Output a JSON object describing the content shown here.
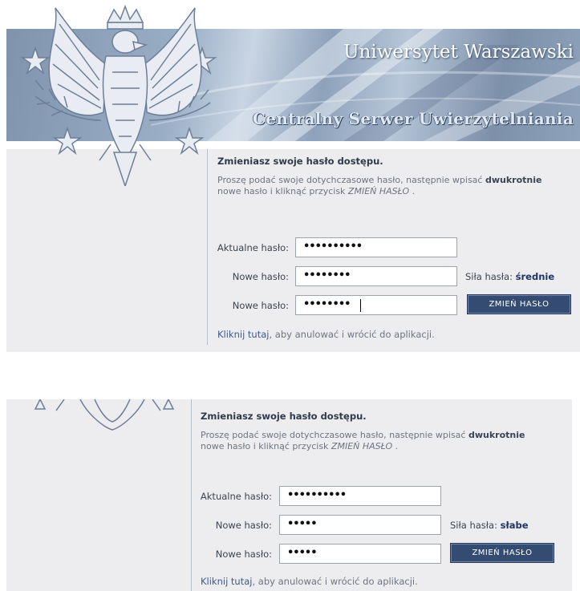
{
  "header": {
    "university": "Uniwersytet Warszawski",
    "service": "Centralny Serwer Uwierzytelniania"
  },
  "colors": {
    "banner": "#8a9eb8",
    "panel": "#ededef",
    "button": "#344b72",
    "link": "#3d5a8c",
    "strength_value": "#1f3566"
  },
  "form1": {
    "heading": "Zmieniasz swoje hasło dostępu.",
    "instr_prefix": "Proszę podać swoje dotychczasowe hasło, następnie wpisać ",
    "instr_bold": "dwukrotnie",
    "instr_mid": "nowe hasło i kliknąć przycisk ",
    "instr_italic": "ZMIEŃ HASŁO",
    "instr_suffix": " .",
    "current_label": "Aktualne hasło:",
    "current_value": "••••••••••",
    "new_label": "Nowe hasło:",
    "new_value": "••••••••",
    "repeat_label": "Nowe hasło:",
    "repeat_value": "••••••••",
    "strength_label": "Siła hasła: ",
    "strength_value": "średnie",
    "submit": "ZMIEŃ HASŁO",
    "cancel_link": "Kliknij tutaj",
    "cancel_text": ", aby anulować i wrócić do aplikacji."
  },
  "form2": {
    "heading": "Zmieniasz swoje hasło dostępu.",
    "instr_prefix": "Proszę podać swoje dotychczasowe hasło, następnie wpisać ",
    "instr_bold": "dwukrotnie",
    "instr_mid": "nowe hasło i kliknąć przycisk ",
    "instr_italic": "ZMIEŃ HASŁO",
    "instr_suffix": " .",
    "current_label": "Aktualne hasło:",
    "current_value": "••••••••••",
    "new_label": "Nowe hasło:",
    "new_value": "•••••",
    "repeat_label": "Nowe hasło:",
    "repeat_value": "•••••",
    "strength_label": "Siła hasła: ",
    "strength_value": "słabe",
    "submit": "ZMIEŃ HASŁO",
    "cancel_link": "Kliknij tutaj",
    "cancel_text": ", aby anulować i wrócić do aplikacji."
  }
}
